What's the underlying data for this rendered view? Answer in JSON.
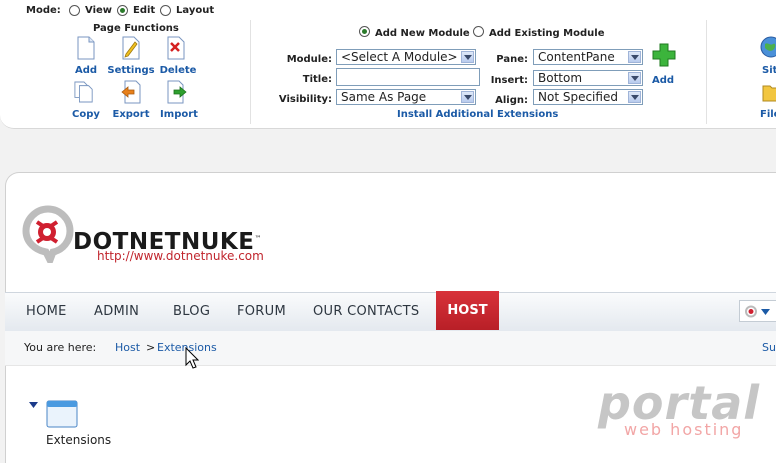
{
  "control_panel": {
    "mode_label": "Mode:",
    "modes": [
      "View",
      "Edit",
      "Layout"
    ],
    "mode_selected": "Edit",
    "page_functions": {
      "title": "Page Functions",
      "actions": [
        "Add",
        "Settings",
        "Delete",
        "Copy",
        "Export",
        "Import"
      ]
    },
    "module": {
      "add_new_label": "Add New Module",
      "add_existing_label": "Add Existing Module",
      "selected_option": "Add New Module",
      "module_label": "Module:",
      "module_value": "<Select A Module>",
      "title_label": "Title:",
      "title_value": "",
      "visibility_label": "Visibility:",
      "visibility_value": "Same As Page",
      "pane_label": "Pane:",
      "pane_value": "ContentPane",
      "insert_label": "Insert:",
      "insert_value": "Bottom",
      "align_label": "Align:",
      "align_value": "Not Specified",
      "add_label": "Add",
      "install_link": "Install Additional Extensions"
    },
    "right_partial": [
      "Sit",
      "File"
    ]
  },
  "skin": {
    "logo_text": "DOTNETNUKE",
    "logo_tm": "™",
    "logo_url": "http://www.dotnetnuke.com",
    "nav": [
      "HOME",
      "ADMIN",
      "BLOG",
      "FORUM",
      "OUR CONTACTS",
      "HOST"
    ],
    "active_nav": "HOST",
    "breadcrumb_label": "You are here:",
    "breadcrumb": [
      "Host",
      ">",
      "Extensions"
    ],
    "right_partial_link": "Su",
    "content_item_label": "Extensions"
  },
  "watermark": {
    "title": "portal",
    "subtitle": "web hosting"
  },
  "colors": {
    "link": "#1b5aa6",
    "accent_red": "#c0242c",
    "host_tab": "#c8222a"
  }
}
